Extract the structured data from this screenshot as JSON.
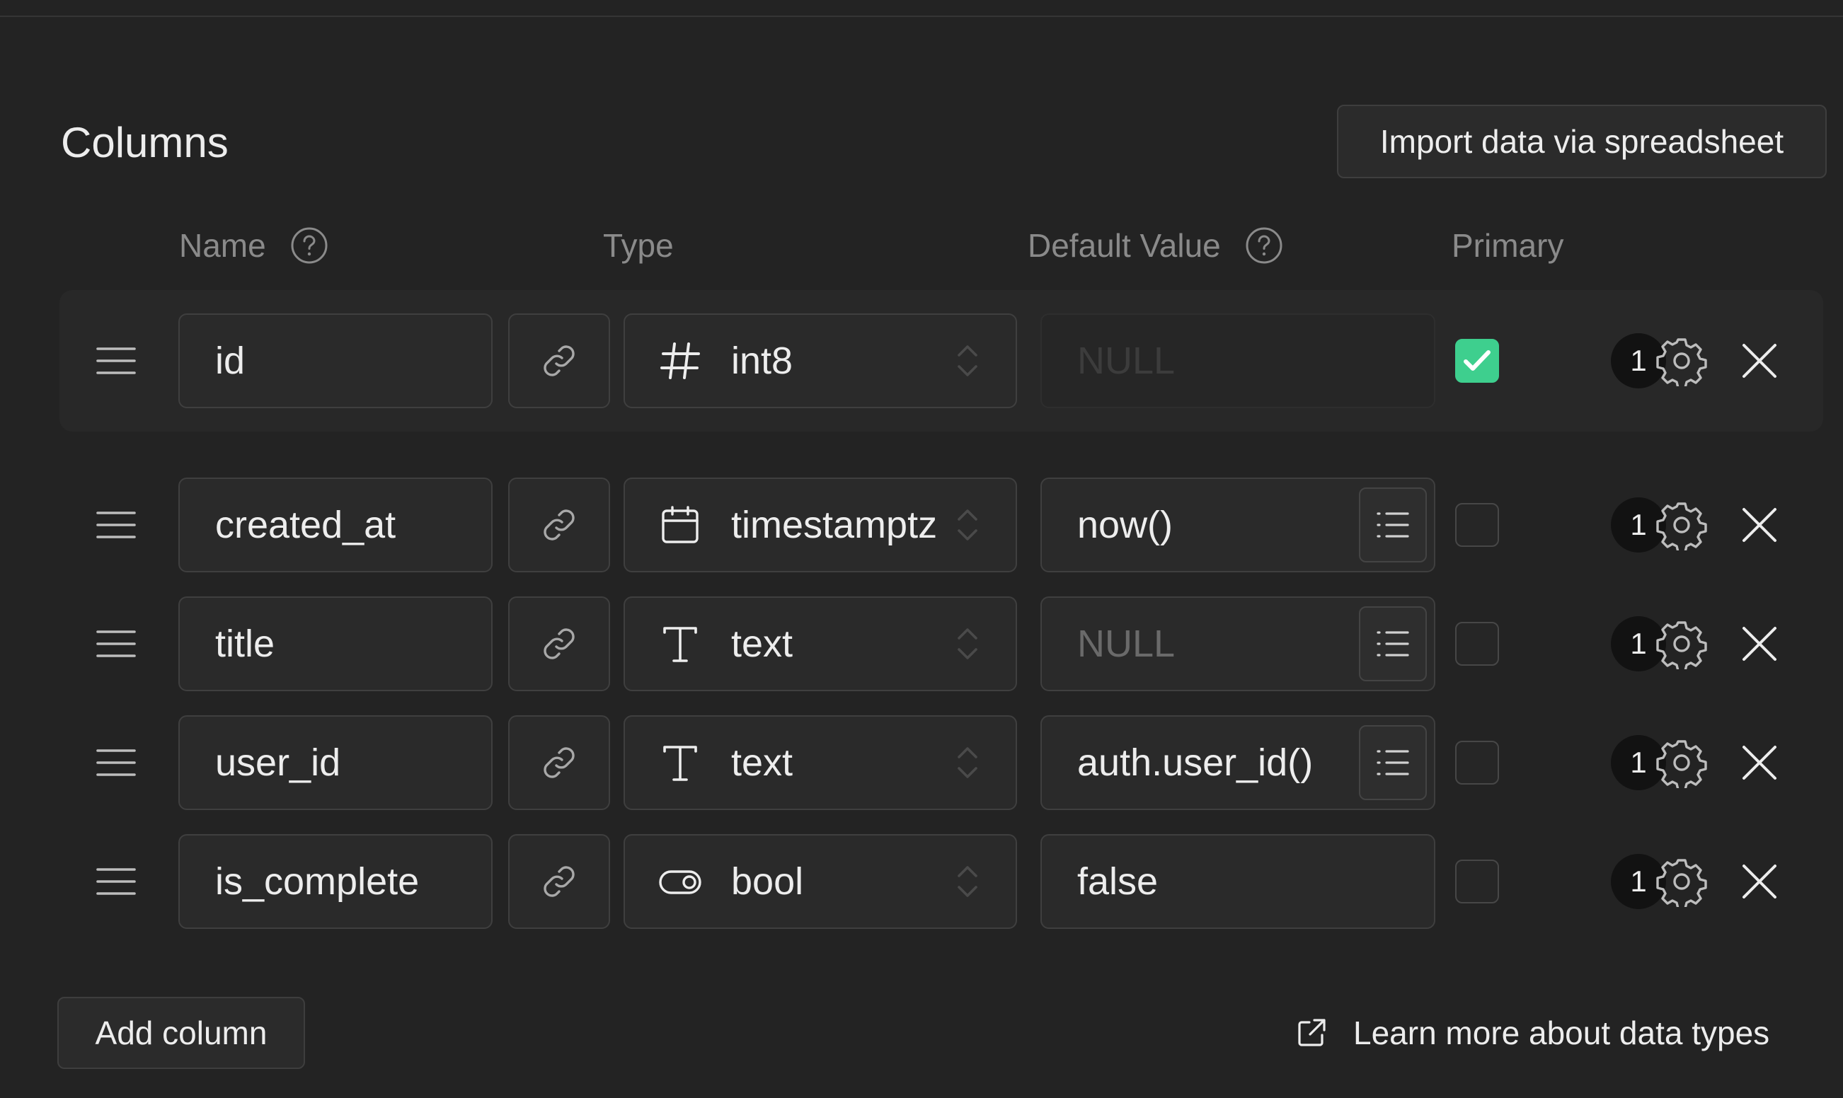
{
  "section": {
    "title": "Columns",
    "import_button": "Import data via spreadsheet",
    "add_column_button": "Add column",
    "learn_more_link": "Learn more about data types"
  },
  "headers": {
    "name": "Name",
    "type": "Type",
    "default_value": "Default Value",
    "primary": "Primary"
  },
  "columns": [
    {
      "name": "id",
      "type": "int8",
      "type_icon": "hash-icon",
      "default_value": "",
      "default_placeholder": "NULL",
      "default_disabled": true,
      "has_suggestions": false,
      "primary": true,
      "badge": "1"
    },
    {
      "name": "created_at",
      "type": "timestamptz",
      "type_icon": "calendar-icon",
      "default_value": "now()",
      "default_placeholder": "NULL",
      "default_disabled": false,
      "has_suggestions": true,
      "primary": false,
      "badge": "1"
    },
    {
      "name": "title",
      "type": "text",
      "type_icon": "text-type-icon",
      "default_value": "",
      "default_placeholder": "NULL",
      "default_disabled": false,
      "has_suggestions": true,
      "primary": false,
      "badge": "1"
    },
    {
      "name": "user_id",
      "type": "text",
      "type_icon": "text-type-icon",
      "default_value": "auth.user_id()",
      "default_placeholder": "NULL",
      "default_disabled": false,
      "has_suggestions": true,
      "primary": false,
      "badge": "1"
    },
    {
      "name": "is_complete",
      "type": "bool",
      "type_icon": "toggle-icon",
      "default_value": "false",
      "default_placeholder": "NULL",
      "default_disabled": false,
      "has_suggestions": false,
      "primary": false,
      "badge": "1"
    }
  ],
  "colors": {
    "background": "#232323",
    "accent": "#3ecf8e",
    "muted_text": "#8a8a8a"
  }
}
